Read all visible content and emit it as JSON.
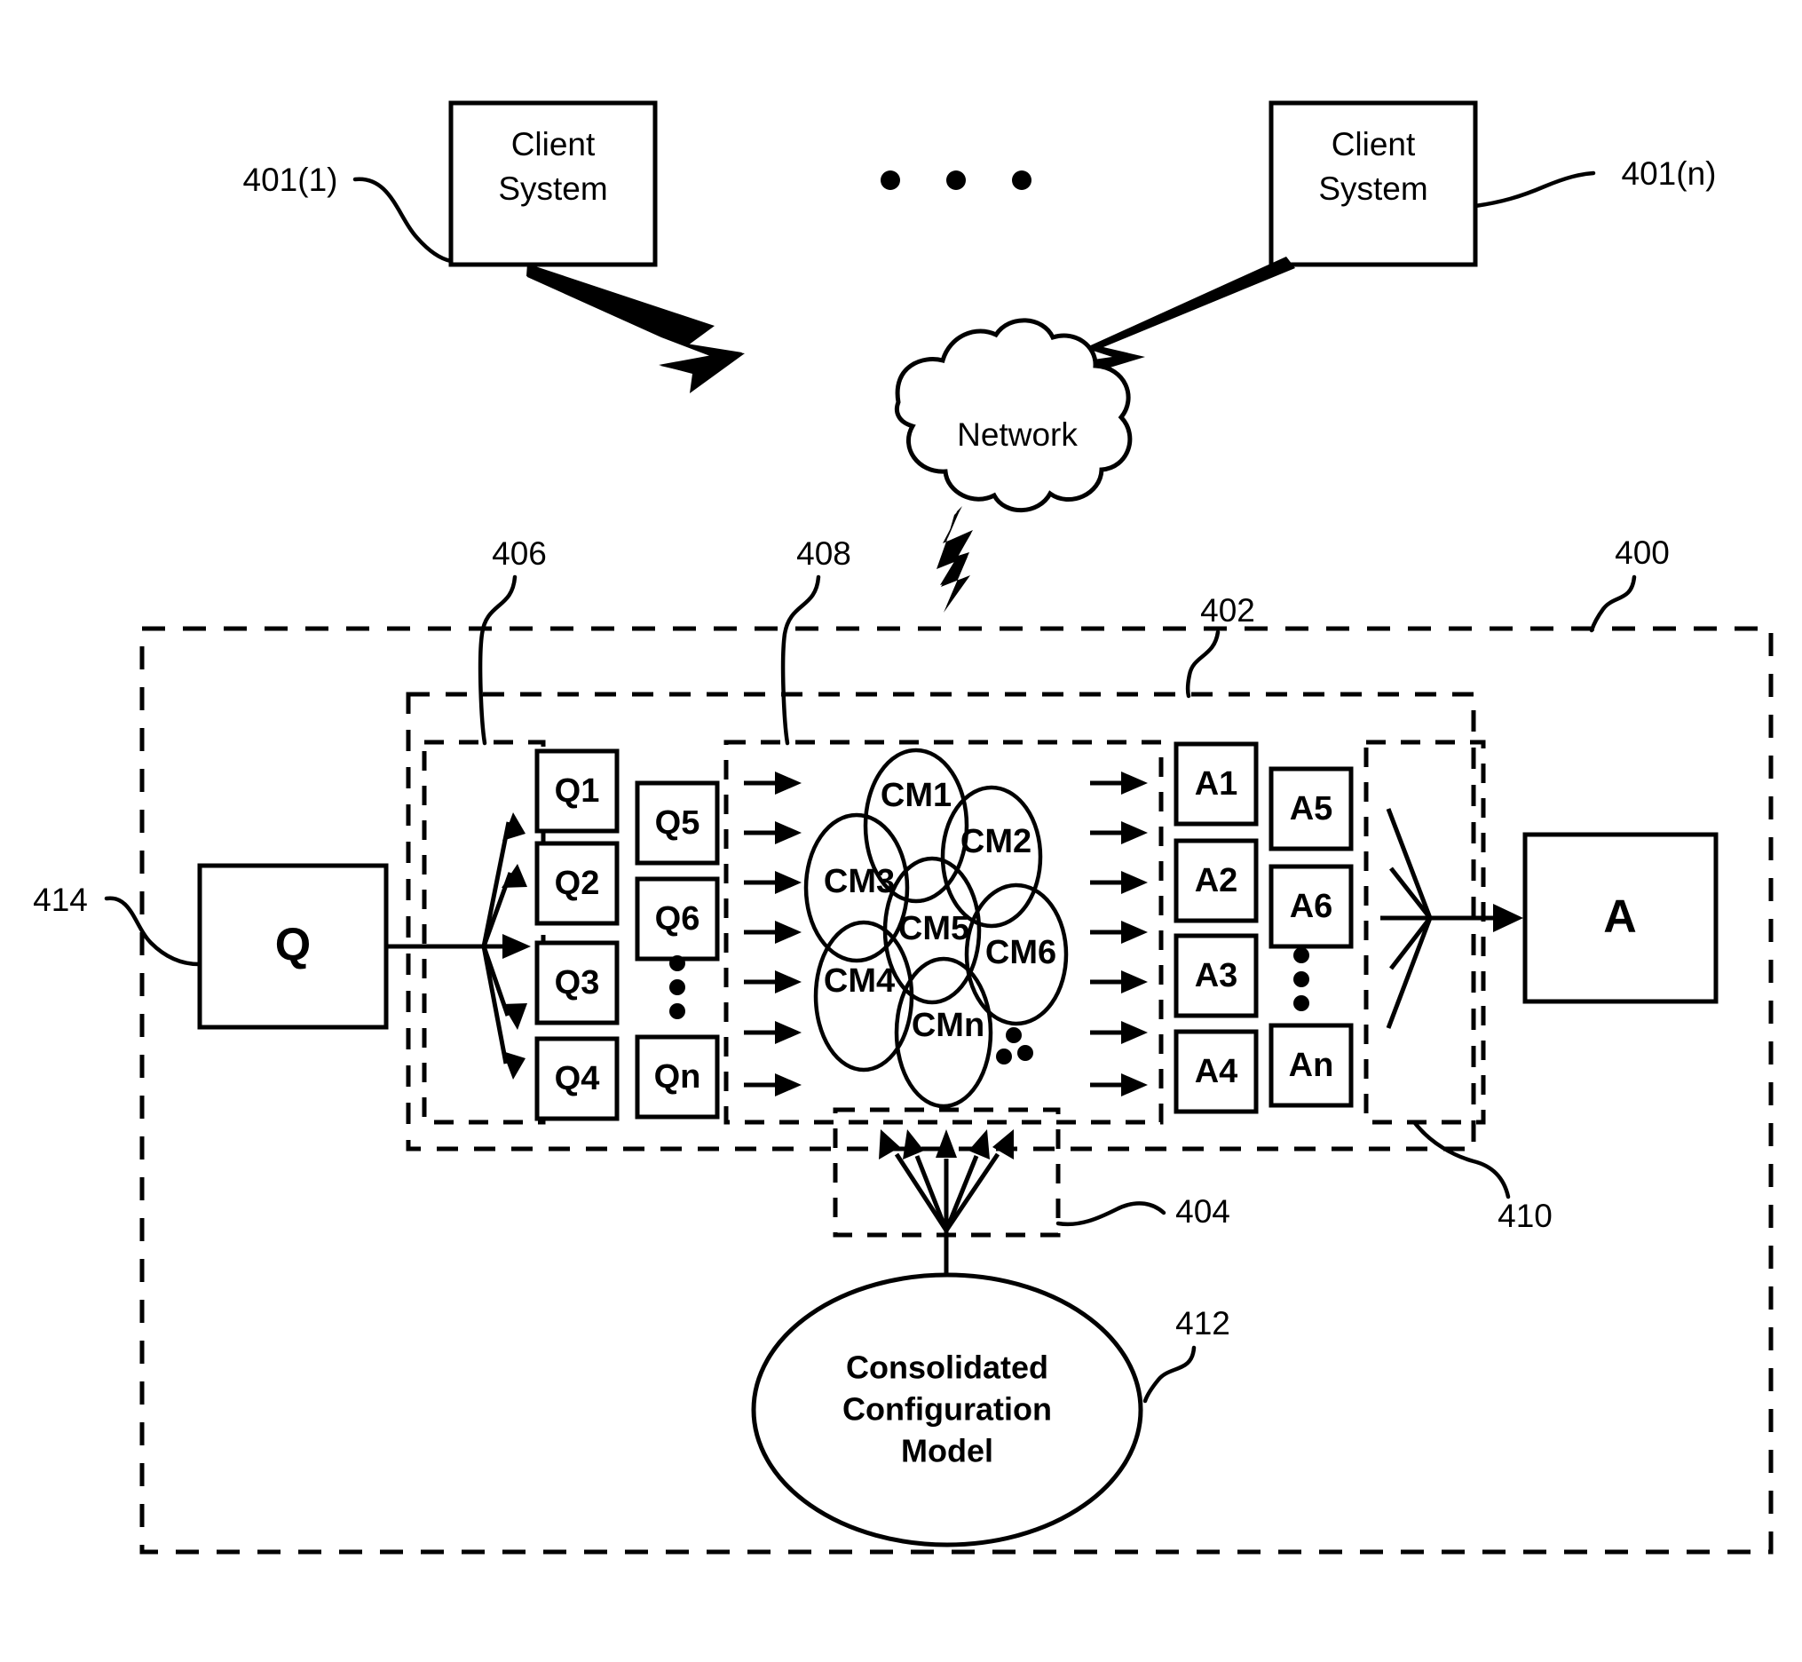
{
  "figure": {
    "number": "400",
    "type": "patent-diagram",
    "title": ""
  },
  "clients": {
    "left": {
      "label": "Client\nSystem",
      "line1": "Client",
      "line2": "System",
      "ref": "401(1)"
    },
    "right": {
      "label": "Client\nSystem",
      "line1": "Client",
      "line2": "System",
      "ref": "401(n)"
    },
    "ellipsis_dots": 3
  },
  "network": {
    "label": "Network"
  },
  "refs": {
    "system": "400",
    "engine": "402",
    "config_bus": "404",
    "query_splitter": "406",
    "model_bank": "408",
    "answer_merger": "410",
    "ccm": "412",
    "query_input": "414"
  },
  "query": {
    "input_label": "Q",
    "column_a": [
      "Q1",
      "Q2",
      "Q3",
      "Q4"
    ],
    "column_b": [
      "Q5",
      "Q6",
      "Qn"
    ],
    "ellipsis_dots": 3
  },
  "answer": {
    "output_label": "A",
    "column_a": [
      "A1",
      "A2",
      "A3",
      "A4"
    ],
    "column_b": [
      "A5",
      "A6",
      "An"
    ],
    "ellipsis_dots": 3
  },
  "config_models": {
    "labels": [
      "CM1",
      "CM2",
      "CM3",
      "CM4",
      "CM5",
      "CM6",
      "CMn"
    ],
    "ellipsis_dots": 3,
    "input_arrows": 7,
    "output_arrows": 7
  },
  "ccm": {
    "line1": "Consolidated",
    "line2": "Configuration",
    "line3": "Model"
  },
  "colors": {
    "stroke": "#000000",
    "background": "#ffffff"
  }
}
